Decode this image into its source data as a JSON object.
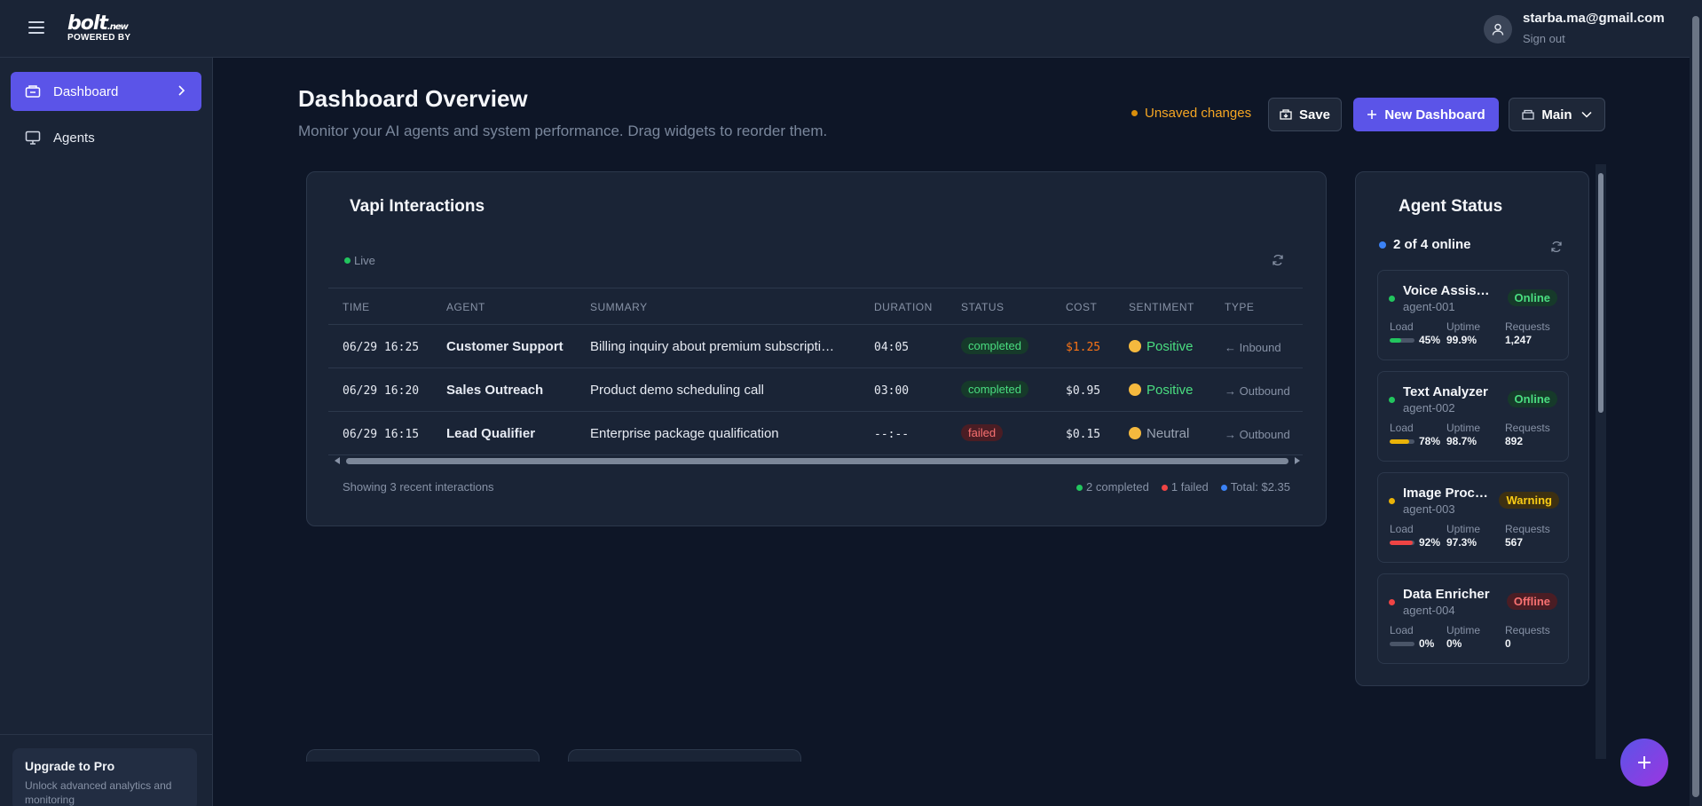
{
  "topbar": {
    "brand": "bolt",
    "brand_suffix": ".new",
    "powered_by": "POWERED BY",
    "user_email": "starba.ma@gmail.com",
    "sign_out": "Sign out"
  },
  "sidebar": {
    "items": [
      {
        "label": "Dashboard",
        "icon": "dashboard-icon",
        "active": true
      },
      {
        "label": "Agents",
        "icon": "monitor-icon",
        "active": false
      }
    ],
    "upgrade": {
      "title": "Upgrade to Pro",
      "desc": "Unlock advanced analytics and monitoring"
    }
  },
  "header": {
    "title": "Dashboard Overview",
    "subtitle": "Monitor your AI agents and system performance. Drag widgets to reorder them.",
    "unsaved": "Unsaved changes",
    "save_label": "Save",
    "new_label": "New Dashboard",
    "main_label": "Main"
  },
  "vapi": {
    "title": "Vapi Interactions",
    "live": "Live",
    "columns": [
      "TIME",
      "AGENT",
      "SUMMARY",
      "DURATION",
      "STATUS",
      "COST",
      "SENTIMENT",
      "TYPE"
    ],
    "rows": [
      {
        "time": "06/29 16:25",
        "agent": "Customer Support",
        "summary": "Billing inquiry about premium subscripti…",
        "duration": "04:05",
        "status": "completed",
        "cost": "$1.25",
        "sentiment": "Positive",
        "type": "← Inbound"
      },
      {
        "time": "06/29 16:20",
        "agent": "Sales Outreach",
        "summary": "Product demo scheduling call",
        "duration": "03:00",
        "status": "completed",
        "cost": "$0.95",
        "sentiment": "Positive",
        "type": "→ Outbound"
      },
      {
        "time": "06/29 16:15",
        "agent": "Lead Qualifier",
        "summary": "Enterprise package qualification",
        "duration": "--:--",
        "status": "failed",
        "cost": "$0.15",
        "sentiment": "Neutral",
        "type": "→ Outbound"
      }
    ],
    "footer_left": "Showing 3 recent interactions",
    "footer_completed": "2 completed",
    "footer_failed": "1 failed",
    "footer_total": "Total: $2.35"
  },
  "agent_status": {
    "title": "Agent Status",
    "online_summary": "2 of 4 online",
    "labels": {
      "load": "Load",
      "uptime": "Uptime",
      "requests": "Requests"
    },
    "agents": [
      {
        "name": "Voice Assistant",
        "id": "agent-001",
        "status": "Online",
        "load": "45%",
        "load_value": 0.45,
        "load_color": "#22c55e",
        "uptime": "99.9%",
        "requests": "1,247",
        "dot": "#22c55e"
      },
      {
        "name": "Text Analyzer",
        "id": "agent-002",
        "status": "Online",
        "load": "78%",
        "load_value": 0.78,
        "load_color": "#eab308",
        "uptime": "98.7%",
        "requests": "892",
        "dot": "#22c55e"
      },
      {
        "name": "Image Processor",
        "id": "agent-003",
        "status": "Warning",
        "load": "92%",
        "load_value": 0.92,
        "load_color": "#ef4444",
        "uptime": "97.3%",
        "requests": "567",
        "dot": "#eab308"
      },
      {
        "name": "Data Enricher",
        "id": "agent-004",
        "status": "Offline",
        "load": "0%",
        "load_value": 0,
        "load_color": "#6b7280",
        "uptime": "0%",
        "requests": "0",
        "dot": "#ef4444"
      }
    ]
  },
  "colors": {
    "accent": "#5b54e8",
    "positive": "#4ade80",
    "cost_high": "#f97316",
    "warning": "#f5a623"
  }
}
